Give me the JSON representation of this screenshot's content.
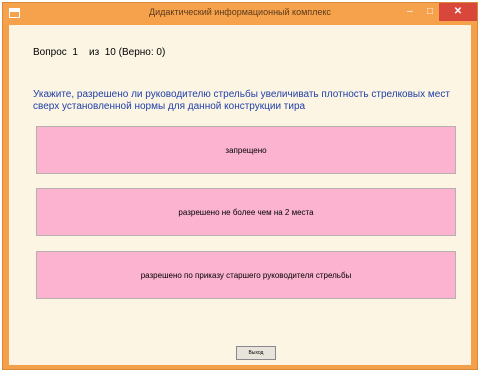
{
  "window": {
    "title": "Дидактический информационный комплекс",
    "minimize_icon": "minimize-icon",
    "maximize_icon": "maximize-icon",
    "close_icon": "close-icon",
    "minimize_glyph": "‒",
    "maximize_glyph": "□",
    "close_glyph": "✕"
  },
  "quiz": {
    "counter": "Вопрос  1    из  10 (Верно: 0)",
    "question": "Укажите, разрешено ли руководителю стрельбы увеличивать плотность стрелковых мест сверх установленной нормы для данной конструкции тира",
    "answers": [
      "запрещено",
      "разрешено не более чем на 2 места",
      "разрешено по приказу старшего руководителя стрельбы"
    ],
    "exit_label": "Выход"
  },
  "colors": {
    "titlebar": "#f6a24c",
    "client_background": "#fcf5e4",
    "answer_background": "#fbb3cf",
    "question_text": "#1f3fa8",
    "close_button": "#d9463a"
  }
}
